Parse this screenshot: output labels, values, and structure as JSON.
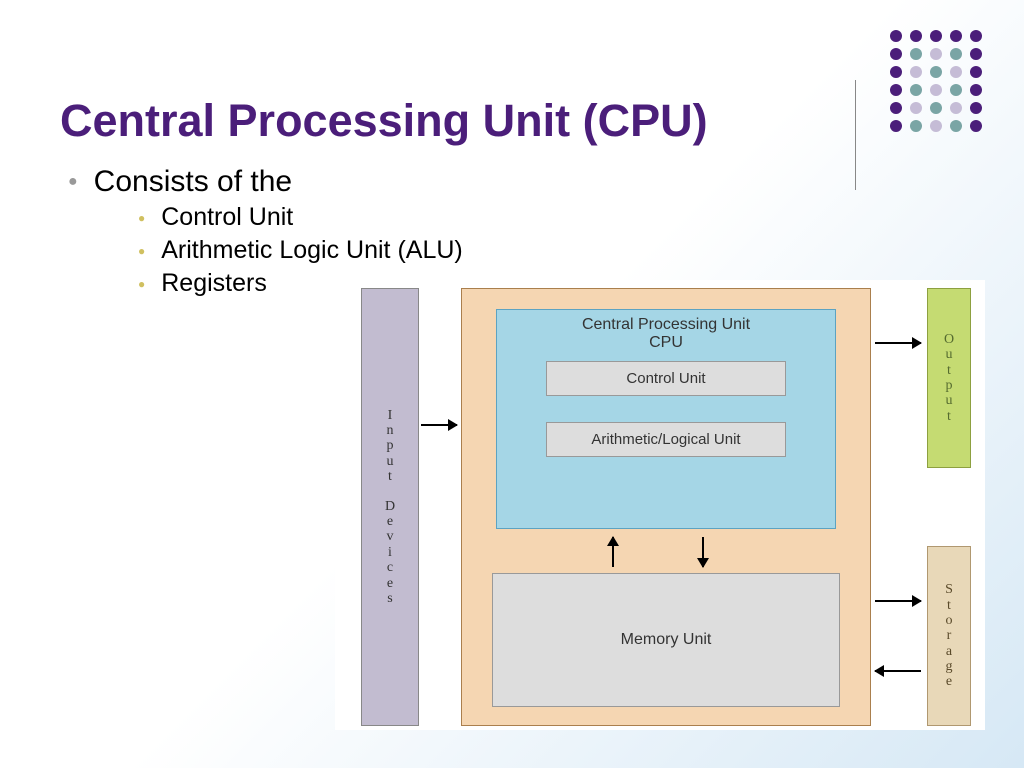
{
  "title": "Central Processing Unit (CPU)",
  "bullets": {
    "main": "Consists of the",
    "sub": [
      "Control Unit",
      "Arithmetic Logic Unit (ALU)",
      "Registers"
    ]
  },
  "diagram": {
    "input_devices": "Input Devices",
    "cpu_label_line1": "Central Processing Unit",
    "cpu_label_line2": "CPU",
    "control_unit": "Control Unit",
    "alu": "Arithmetic/Logical Unit",
    "memory_unit": "Memory Unit",
    "output": "Output",
    "storage": "Storage"
  }
}
